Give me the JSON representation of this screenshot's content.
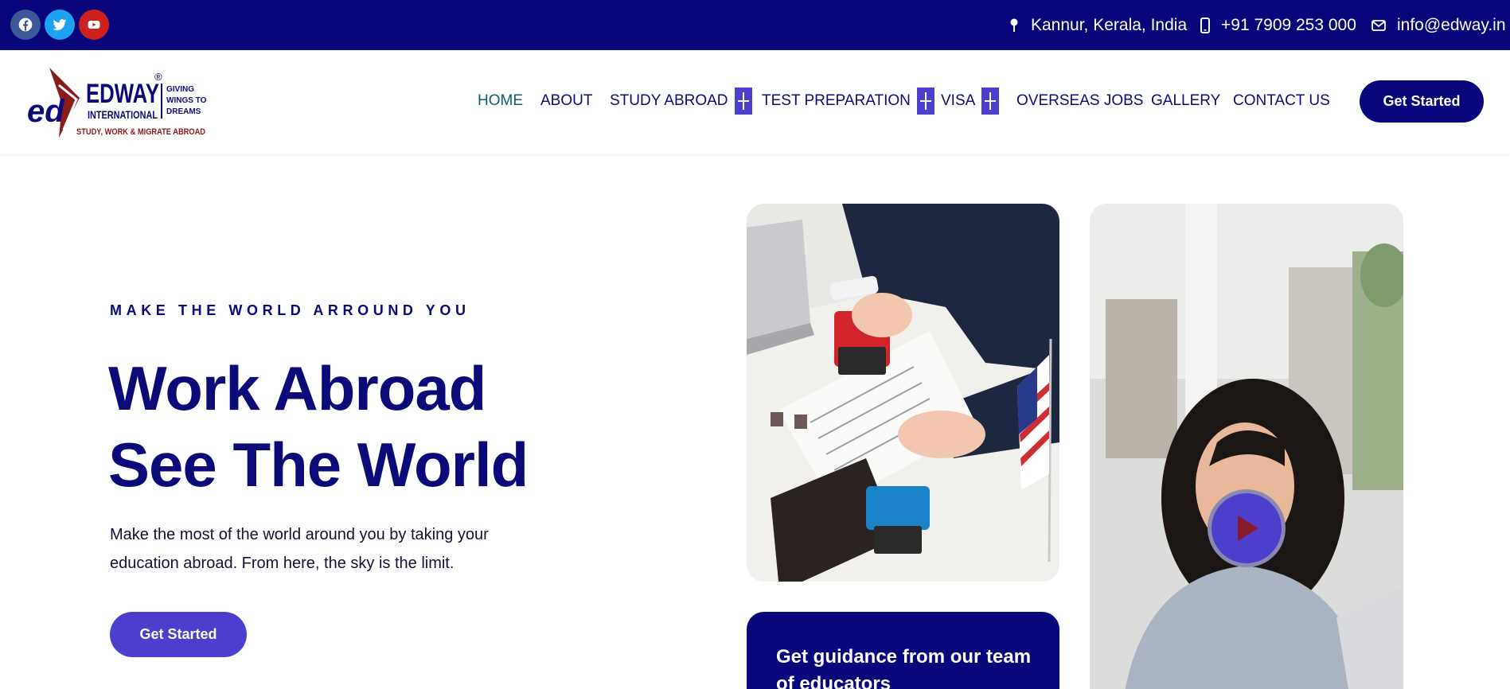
{
  "topbar": {
    "social": [
      {
        "icon": "facebook-icon",
        "color": "#3b5998"
      },
      {
        "icon": "twitter-icon",
        "color": "#1da1f2"
      },
      {
        "icon": "youtube-icon",
        "color": "#cd201f"
      }
    ],
    "location": "Kannur, Kerala, India",
    "phone": "+91 7909 253 000",
    "email": "info@edway.in"
  },
  "logo": {
    "brand": "EDWAY",
    "sub": "INTERNATIONAL",
    "monogram": "ed",
    "tagline_lines": [
      "GIVING",
      "WINGS TO",
      "DREAMS"
    ],
    "strapline": "STUDY, WORK & MIGRATE ABROAD",
    "registered": "®"
  },
  "nav": {
    "items": [
      {
        "label": "HOME",
        "active": true
      },
      {
        "label": "ABOUT"
      },
      {
        "label": "STUDY ABROAD",
        "expandable": true
      },
      {
        "label": "TEST PREPARATION",
        "expandable": true
      },
      {
        "label": "VISA",
        "expandable": true
      },
      {
        "label": "OVERSEAS JOBS"
      },
      {
        "label": "GALLERY"
      },
      {
        "label": "CONTACT US"
      }
    ],
    "cta": "Get Started"
  },
  "hero": {
    "eyebrow": "MAKE THE WORLD ARROUND YOU",
    "title_line1": "Work Abroad",
    "title_line2": "See The World",
    "desc_line1": "Make the most of the world around you by taking your",
    "desc_line2": "education abroad. From here, the sky is the limit.",
    "cta": "Get Started"
  },
  "cards": {
    "guidance_line1": "Get guidance from our team",
    "guidance_line2": "of educators"
  },
  "colors": {
    "navy": "#08067a",
    "accent": "#4b3fcc",
    "home_active": "#0b5f6e",
    "logo_red": "#8b1a1a"
  }
}
